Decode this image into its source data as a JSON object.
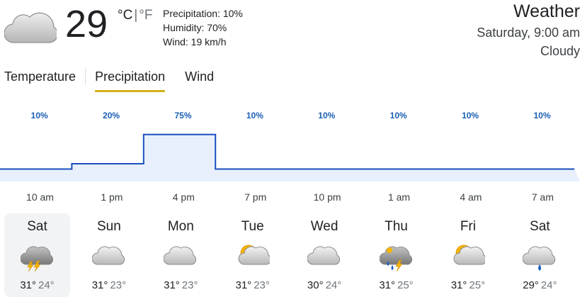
{
  "current": {
    "temperature": "29",
    "unit_c": "°C",
    "unit_sep": "|",
    "unit_f": "°F",
    "precipitation": "Precipitation: 10%",
    "humidity": "Humidity: 70%",
    "wind": "Wind: 19 km/h",
    "icon": "cloud-icon"
  },
  "header": {
    "title": "Weather",
    "datetime": "Saturday, 9:00 am",
    "condition": "Cloudy"
  },
  "tabs": [
    {
      "label": "Temperature",
      "active": false
    },
    {
      "label": "Precipitation",
      "active": true
    },
    {
      "label": "Wind",
      "active": false
    }
  ],
  "chart_data": {
    "type": "area",
    "x": [
      "10 am",
      "1 pm",
      "4 pm",
      "7 pm",
      "10 pm",
      "1 am",
      "4 am",
      "7 am"
    ],
    "labels": [
      "10%",
      "20%",
      "75%",
      "10%",
      "10%",
      "10%",
      "10%",
      "10%"
    ],
    "values": [
      10,
      20,
      75,
      10,
      10,
      10,
      10,
      10
    ],
    "ylim": [
      0,
      100
    ],
    "colors": {
      "line": "#1a4fbf",
      "fill": "#e8f0fe",
      "label": "#1a5fb4"
    }
  },
  "days": [
    {
      "name": "Sat",
      "hi": "31°",
      "lo": "24°",
      "icon": "thunderstorm-icon",
      "selected": true
    },
    {
      "name": "Sun",
      "hi": "31°",
      "lo": "23°",
      "icon": "cloud-icon",
      "selected": false
    },
    {
      "name": "Mon",
      "hi": "31°",
      "lo": "23°",
      "icon": "cloud-icon",
      "selected": false
    },
    {
      "name": "Tue",
      "hi": "31°",
      "lo": "23°",
      "icon": "partly-cloudy-icon",
      "selected": false
    },
    {
      "name": "Wed",
      "hi": "30°",
      "lo": "24°",
      "icon": "cloud-icon",
      "selected": false
    },
    {
      "name": "Thu",
      "hi": "31°",
      "lo": "25°",
      "icon": "storm-rain-icon",
      "selected": false
    },
    {
      "name": "Fri",
      "hi": "31°",
      "lo": "25°",
      "icon": "partly-cloudy-icon",
      "selected": false
    },
    {
      "name": "Sat",
      "hi": "29°",
      "lo": "24°",
      "icon": "rain-icon",
      "selected": false
    }
  ]
}
